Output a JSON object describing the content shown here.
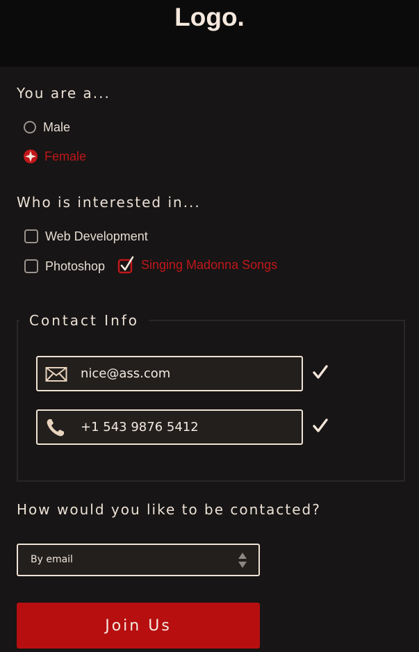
{
  "header": {
    "logo": "Logo."
  },
  "gender": {
    "heading": "You are a...",
    "options": [
      {
        "label": "Male",
        "selected": false
      },
      {
        "label": "Female",
        "selected": true
      }
    ]
  },
  "interests": {
    "heading": "Who is interested in...",
    "options": [
      {
        "label": "Web Development",
        "checked": false
      },
      {
        "label": "Photoshop",
        "checked": false
      },
      {
        "label": "Singing Madonna Songs",
        "checked": true
      }
    ]
  },
  "contact": {
    "legend": "Contact Info",
    "email": {
      "value": "nice@ass.com",
      "icon": "mail-icon",
      "valid": true
    },
    "phone": {
      "value": "+1 543 9876 5412",
      "icon": "phone-icon",
      "valid": true
    }
  },
  "preference": {
    "heading": "How would you like to be contacted?",
    "selected": "By email"
  },
  "submit": {
    "label": "Join Us"
  },
  "colors": {
    "background": "#171515",
    "header": "#0b0b0b",
    "accent": "#b70f10",
    "text": "#ece1d6"
  }
}
